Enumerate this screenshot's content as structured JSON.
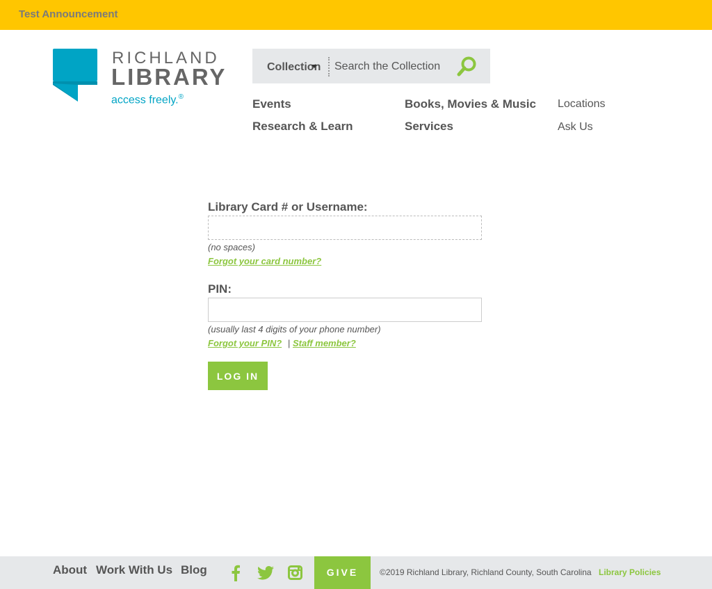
{
  "announcement": {
    "text": "Test Announcement",
    "bg_color": "#ffc600"
  },
  "logo": {
    "line1": "RICHLAND",
    "line2": "LIBRARY",
    "tagline": "access freely.",
    "tagline_mark": "®",
    "icon": "speech-bubble-icon",
    "brand_color": "#00a4c5"
  },
  "search": {
    "scope_label": "Collection",
    "placeholder": "Search the Collection",
    "icon": "search-icon"
  },
  "nav": {
    "primary": [
      "Events",
      "Research & Learn",
      "Books, Movies & Music",
      "Services"
    ],
    "secondary": [
      "Locations",
      "Ask Us"
    ]
  },
  "form": {
    "card_label": "Library Card # or Username:",
    "card_hint": "(no spaces)",
    "card_forgot": "Forgot your card number?",
    "pin_label": "PIN:",
    "pin_hint": "(usually last 4 digits of your phone number)",
    "pin_forgot": "Forgot your PIN?",
    "separator": "|",
    "staff": "Staff member?",
    "submit": "LOG IN",
    "accent_color": "#8cc63f"
  },
  "footer": {
    "links": [
      "About",
      "Work With Us",
      "Blog"
    ],
    "social": [
      "facebook-icon",
      "twitter-icon",
      "instagram-icon"
    ],
    "give": "GIVE",
    "copyright": "©2019 Richland Library, Richland County, South Carolina",
    "policies": "Library Policies"
  }
}
